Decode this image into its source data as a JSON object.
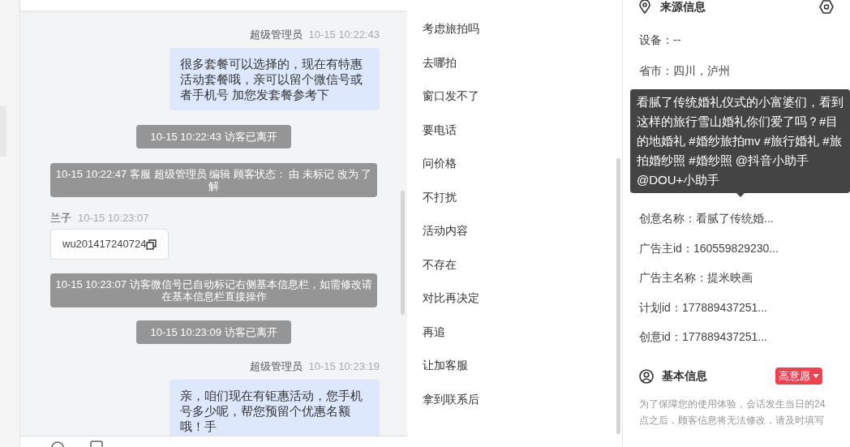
{
  "chat": {
    "messages": [
      {
        "kind": "agent",
        "sender": "超级管理员",
        "time": "10-15 10:22:43",
        "text": "很多套餐可以选择的，现在有特惠活动套餐哦，亲可以留个微信号或者手机号 加您发套餐参考下"
      },
      {
        "kind": "system",
        "wide": false,
        "text": "10-15 10:22:43 访客已离开"
      },
      {
        "kind": "system",
        "wide": true,
        "text": "10-15 10:22:47 客服 超级管理员 编辑 顾客状态： 由 未标记 改为 了解"
      },
      {
        "kind": "visitor",
        "sender": "兰子",
        "time": "10-15 10:23:07"
      },
      {
        "kind": "card",
        "text": "wu201417240724"
      },
      {
        "kind": "system",
        "wide": true,
        "text": "10-15 10:23:07 访客微信号已自动标记右侧基本信息栏，如需修改请在基本信息栏直接操作"
      },
      {
        "kind": "system",
        "wide": false,
        "text": "10-15 10:23:09 访客已离开"
      },
      {
        "kind": "agent",
        "sender": "超级管理员",
        "time": "10-15 10:23:19",
        "text": "亲，咱们现在有钜惠活动，您手机号多少呢，帮您预留个优惠名额哦！手"
      }
    ]
  },
  "quick_replies": [
    "考虑旅拍吗",
    "去哪拍",
    "窗口发不了",
    "要电话",
    "问价格",
    "不打扰",
    "活动内容",
    "不存在",
    "对比再决定",
    "再追",
    "让加客服",
    "拿到联系后"
  ],
  "source_info": {
    "title": "来源信息",
    "rows_above": [
      "设备：--",
      "省市：四川，泸州"
    ],
    "tooltip": "看腻了传统婚礼仪式的小富婆们，看到这样的旅行雪山婚礼你们爱了吗？#目的地婚礼 #婚纱旅拍mv #旅行婚礼 #旅拍婚纱照 #婚纱照 @抖音小助手 @DOU+小助手",
    "rows_below": [
      "创意名称：看腻了传统婚...",
      "广告主id：160559829230...",
      "广告主名称：提米映画",
      "计划id：177889437251...",
      "创意id：177889437251..."
    ]
  },
  "basic_info": {
    "title": "基本信息",
    "intent": "高意愿",
    "note": "为了保障您的使用体验，会话发生当日的24点之后，顾客信息将无法修改，请及时填写"
  }
}
